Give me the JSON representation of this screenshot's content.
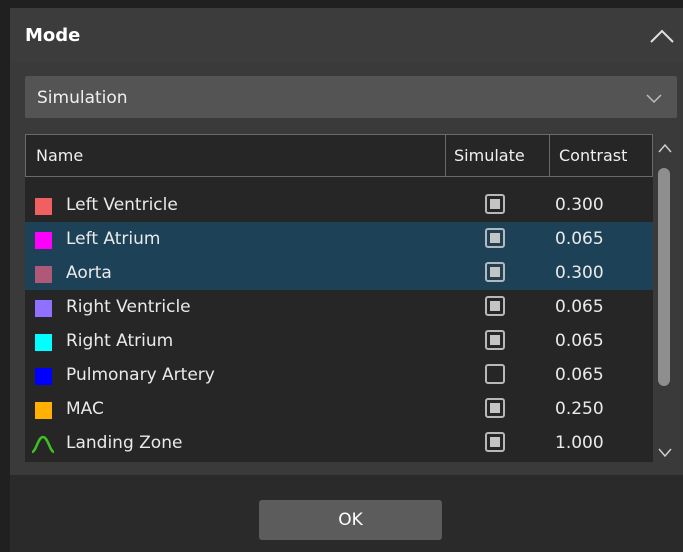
{
  "header": {
    "title": "Mode"
  },
  "mode_select": {
    "value": "Simulation"
  },
  "table": {
    "columns": [
      "Name",
      "Simulate",
      "Contrast"
    ],
    "rows": [
      {
        "name": "Left Ventricle",
        "color": "#f06060",
        "icon": "color-swatch",
        "simulate": true,
        "contrast": "0.300",
        "selected": false
      },
      {
        "name": "Left Atrium",
        "color": "#ff00ff",
        "icon": "color-swatch",
        "simulate": true,
        "contrast": "0.065",
        "selected": true
      },
      {
        "name": "Aorta",
        "color": "#b05878",
        "icon": "color-swatch",
        "simulate": true,
        "contrast": "0.300",
        "selected": true
      },
      {
        "name": "Right Ventricle",
        "color": "#9070ff",
        "icon": "color-swatch",
        "simulate": true,
        "contrast": "0.065",
        "selected": false
      },
      {
        "name": "Right Atrium",
        "color": "#00ffff",
        "icon": "color-swatch",
        "simulate": true,
        "contrast": "0.065",
        "selected": false
      },
      {
        "name": "Pulmonary Artery",
        "color": "#0000ff",
        "icon": "color-swatch",
        "simulate": false,
        "contrast": "0.065",
        "selected": false
      },
      {
        "name": "MAC",
        "color": "#ffb000",
        "icon": "color-swatch",
        "simulate": true,
        "contrast": "0.250",
        "selected": false
      },
      {
        "name": "Landing Zone",
        "color": "#40c020",
        "icon": "wave-icon",
        "simulate": true,
        "contrast": "1.000",
        "selected": false
      },
      {
        "name": "",
        "color": "#d0d060",
        "icon": "color-swatch",
        "simulate": true,
        "contrast": "",
        "selected": false
      }
    ]
  },
  "footer": {
    "ok_label": "OK"
  }
}
